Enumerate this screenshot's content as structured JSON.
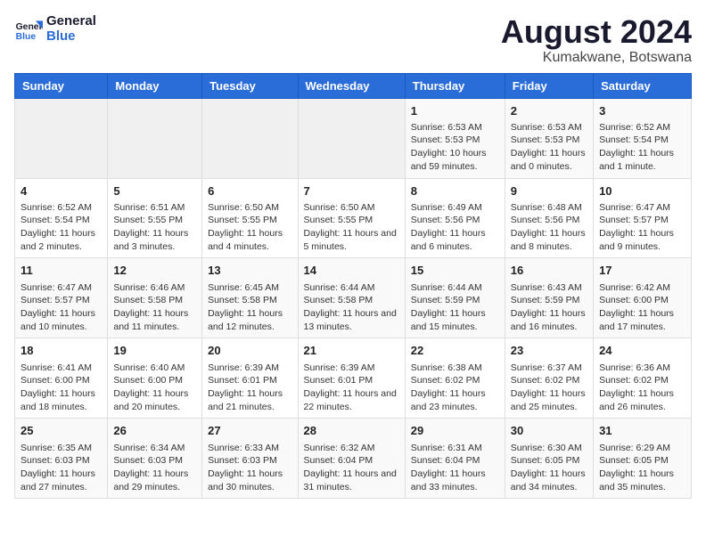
{
  "logo": {
    "line1": "General",
    "line2": "Blue"
  },
  "title": "August 2024",
  "subtitle": "Kumakwane, Botswana",
  "headers": [
    "Sunday",
    "Monday",
    "Tuesday",
    "Wednesday",
    "Thursday",
    "Friday",
    "Saturday"
  ],
  "weeks": [
    [
      {
        "day": "",
        "info": ""
      },
      {
        "day": "",
        "info": ""
      },
      {
        "day": "",
        "info": ""
      },
      {
        "day": "",
        "info": ""
      },
      {
        "day": "1",
        "info": "Sunrise: 6:53 AM\nSunset: 5:53 PM\nDaylight: 10 hours and 59 minutes."
      },
      {
        "day": "2",
        "info": "Sunrise: 6:53 AM\nSunset: 5:53 PM\nDaylight: 11 hours and 0 minutes."
      },
      {
        "day": "3",
        "info": "Sunrise: 6:52 AM\nSunset: 5:54 PM\nDaylight: 11 hours and 1 minute."
      }
    ],
    [
      {
        "day": "4",
        "info": "Sunrise: 6:52 AM\nSunset: 5:54 PM\nDaylight: 11 hours and 2 minutes."
      },
      {
        "day": "5",
        "info": "Sunrise: 6:51 AM\nSunset: 5:55 PM\nDaylight: 11 hours and 3 minutes."
      },
      {
        "day": "6",
        "info": "Sunrise: 6:50 AM\nSunset: 5:55 PM\nDaylight: 11 hours and 4 minutes."
      },
      {
        "day": "7",
        "info": "Sunrise: 6:50 AM\nSunset: 5:55 PM\nDaylight: 11 hours and 5 minutes."
      },
      {
        "day": "8",
        "info": "Sunrise: 6:49 AM\nSunset: 5:56 PM\nDaylight: 11 hours and 6 minutes."
      },
      {
        "day": "9",
        "info": "Sunrise: 6:48 AM\nSunset: 5:56 PM\nDaylight: 11 hours and 8 minutes."
      },
      {
        "day": "10",
        "info": "Sunrise: 6:47 AM\nSunset: 5:57 PM\nDaylight: 11 hours and 9 minutes."
      }
    ],
    [
      {
        "day": "11",
        "info": "Sunrise: 6:47 AM\nSunset: 5:57 PM\nDaylight: 11 hours and 10 minutes."
      },
      {
        "day": "12",
        "info": "Sunrise: 6:46 AM\nSunset: 5:58 PM\nDaylight: 11 hours and 11 minutes."
      },
      {
        "day": "13",
        "info": "Sunrise: 6:45 AM\nSunset: 5:58 PM\nDaylight: 11 hours and 12 minutes."
      },
      {
        "day": "14",
        "info": "Sunrise: 6:44 AM\nSunset: 5:58 PM\nDaylight: 11 hours and 13 minutes."
      },
      {
        "day": "15",
        "info": "Sunrise: 6:44 AM\nSunset: 5:59 PM\nDaylight: 11 hours and 15 minutes."
      },
      {
        "day": "16",
        "info": "Sunrise: 6:43 AM\nSunset: 5:59 PM\nDaylight: 11 hours and 16 minutes."
      },
      {
        "day": "17",
        "info": "Sunrise: 6:42 AM\nSunset: 6:00 PM\nDaylight: 11 hours and 17 minutes."
      }
    ],
    [
      {
        "day": "18",
        "info": "Sunrise: 6:41 AM\nSunset: 6:00 PM\nDaylight: 11 hours and 18 minutes."
      },
      {
        "day": "19",
        "info": "Sunrise: 6:40 AM\nSunset: 6:00 PM\nDaylight: 11 hours and 20 minutes."
      },
      {
        "day": "20",
        "info": "Sunrise: 6:39 AM\nSunset: 6:01 PM\nDaylight: 11 hours and 21 minutes."
      },
      {
        "day": "21",
        "info": "Sunrise: 6:39 AM\nSunset: 6:01 PM\nDaylight: 11 hours and 22 minutes."
      },
      {
        "day": "22",
        "info": "Sunrise: 6:38 AM\nSunset: 6:02 PM\nDaylight: 11 hours and 23 minutes."
      },
      {
        "day": "23",
        "info": "Sunrise: 6:37 AM\nSunset: 6:02 PM\nDaylight: 11 hours and 25 minutes."
      },
      {
        "day": "24",
        "info": "Sunrise: 6:36 AM\nSunset: 6:02 PM\nDaylight: 11 hours and 26 minutes."
      }
    ],
    [
      {
        "day": "25",
        "info": "Sunrise: 6:35 AM\nSunset: 6:03 PM\nDaylight: 11 hours and 27 minutes."
      },
      {
        "day": "26",
        "info": "Sunrise: 6:34 AM\nSunset: 6:03 PM\nDaylight: 11 hours and 29 minutes."
      },
      {
        "day": "27",
        "info": "Sunrise: 6:33 AM\nSunset: 6:03 PM\nDaylight: 11 hours and 30 minutes."
      },
      {
        "day": "28",
        "info": "Sunrise: 6:32 AM\nSunset: 6:04 PM\nDaylight: 11 hours and 31 minutes."
      },
      {
        "day": "29",
        "info": "Sunrise: 6:31 AM\nSunset: 6:04 PM\nDaylight: 11 hours and 33 minutes."
      },
      {
        "day": "30",
        "info": "Sunrise: 6:30 AM\nSunset: 6:05 PM\nDaylight: 11 hours and 34 minutes."
      },
      {
        "day": "31",
        "info": "Sunrise: 6:29 AM\nSunset: 6:05 PM\nDaylight: 11 hours and 35 minutes."
      }
    ]
  ]
}
